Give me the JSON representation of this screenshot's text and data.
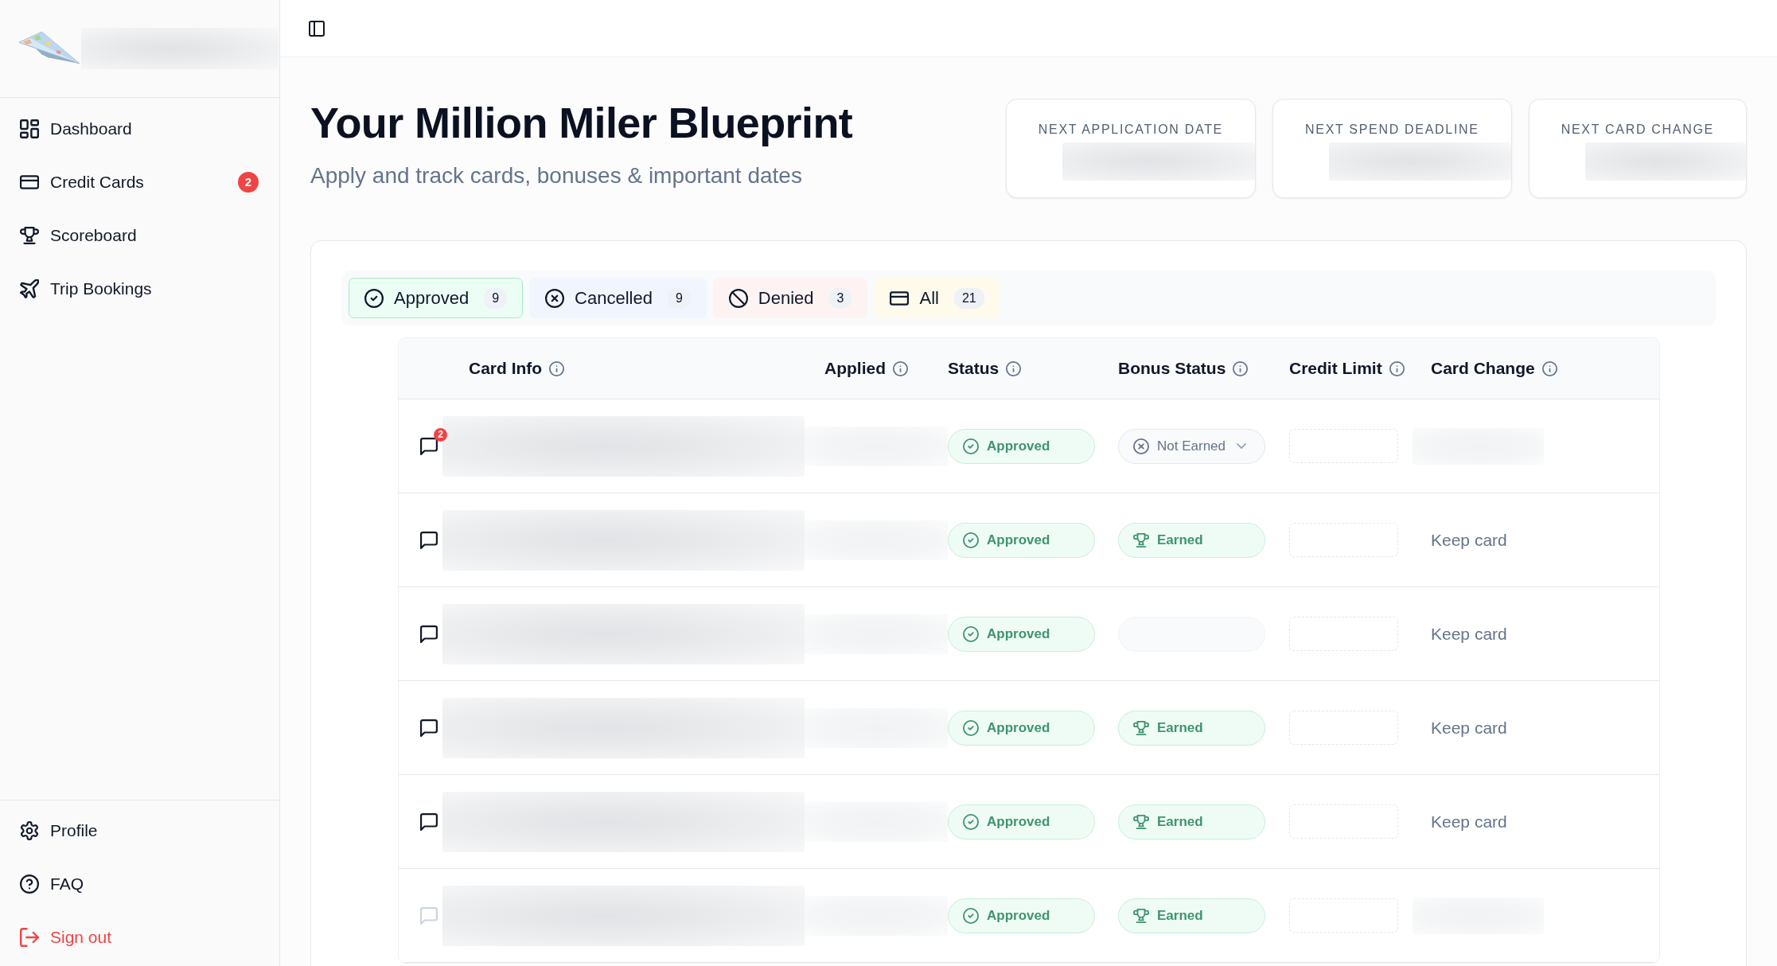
{
  "sidebar": {
    "nav_items": [
      {
        "label": "Dashboard",
        "selected": false
      },
      {
        "label": "Credit Cards",
        "selected": false,
        "badge": "2"
      },
      {
        "label": "Scoreboard",
        "selected": false
      },
      {
        "label": "Trip Bookings",
        "selected": false
      }
    ],
    "footer_items": [
      {
        "label": "Profile",
        "kind": "link"
      },
      {
        "label": "FAQ",
        "kind": "link"
      },
      {
        "label": "Sign out",
        "kind": "danger"
      }
    ]
  },
  "header": {
    "title": "Your Million Miler Blueprint",
    "subtitle": "Apply and track cards, bonuses & important dates",
    "stats": [
      {
        "label": "NEXT APPLICATION DATE"
      },
      {
        "label": "NEXT SPEND DEADLINE"
      },
      {
        "label": "NEXT CARD CHANGE"
      }
    ]
  },
  "filter_tabs": [
    {
      "label": "Approved",
      "count": "9",
      "selected": true,
      "color": "#ecfdf5"
    },
    {
      "label": "Cancelled",
      "count": "9",
      "selected": false,
      "color": "#f1f5fd"
    },
    {
      "label": "Denied",
      "count": "3",
      "selected": false,
      "color": "#fdf3f3"
    },
    {
      "label": "All",
      "count": "21",
      "selected": false,
      "color": "#fefbec"
    }
  ],
  "table": {
    "columns": [
      {
        "label": "Card Info"
      },
      {
        "label": "Applied"
      },
      {
        "label": "Status"
      },
      {
        "label": "Bonus Status"
      },
      {
        "label": "Credit Limit"
      },
      {
        "label": "Card Change"
      }
    ],
    "rows": [
      {
        "notes_active": true,
        "notes_badge": "2",
        "status": {
          "kind": "approved",
          "label": "Approved"
        },
        "bonus": {
          "kind": "not_earned",
          "label": "Not Earned"
        },
        "card_change": {
          "kind": "redacted"
        }
      },
      {
        "notes_active": true,
        "status": {
          "kind": "approved",
          "label": "Approved"
        },
        "bonus": {
          "kind": "earned",
          "label": "Earned"
        },
        "card_change": {
          "kind": "text",
          "text": "Keep card"
        }
      },
      {
        "notes_active": true,
        "status": {
          "kind": "approved",
          "label": "Approved"
        },
        "bonus": {
          "kind": "empty"
        },
        "card_change": {
          "kind": "text",
          "text": "Keep card"
        }
      },
      {
        "notes_active": true,
        "status": {
          "kind": "approved",
          "label": "Approved"
        },
        "bonus": {
          "kind": "earned",
          "label": "Earned"
        },
        "card_change": {
          "kind": "text",
          "text": "Keep card"
        }
      },
      {
        "notes_active": true,
        "status": {
          "kind": "approved",
          "label": "Approved"
        },
        "bonus": {
          "kind": "earned",
          "label": "Earned"
        },
        "card_change": {
          "kind": "text",
          "text": "Keep card"
        }
      },
      {
        "notes_active": false,
        "status": {
          "kind": "approved",
          "label": "Approved"
        },
        "bonus": {
          "kind": "earned",
          "label": "Earned"
        },
        "card_change": {
          "kind": "redacted"
        }
      }
    ]
  }
}
